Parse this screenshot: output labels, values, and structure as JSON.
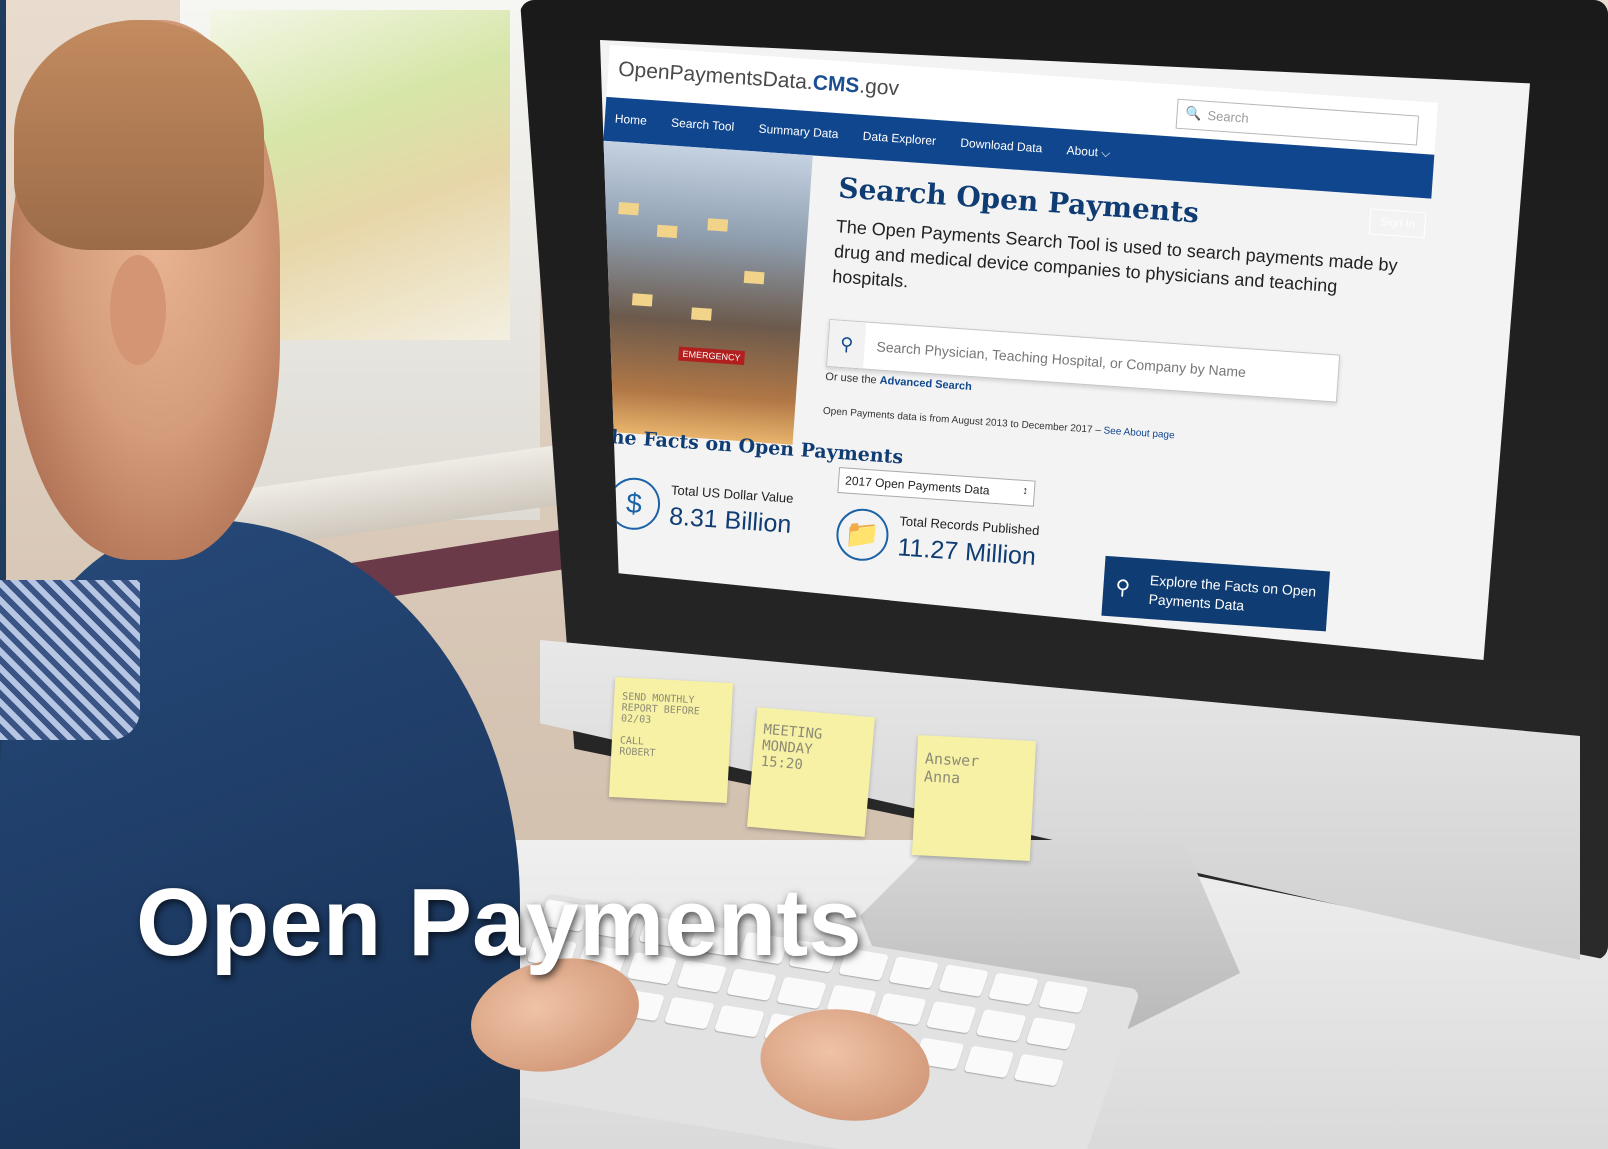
{
  "slide": {
    "title": "Open Payments"
  },
  "site": {
    "logo_prefix": "OpenPaymentsData.",
    "logo_cms": "CMS",
    "logo_suffix": ".gov",
    "nav": [
      "Home",
      "Search Tool",
      "Summary Data",
      "Data Explorer",
      "Download Data",
      "About ⌵"
    ],
    "search_placeholder": "Search",
    "sign_in": "Sign In"
  },
  "hero": {
    "title": "Search Open Payments",
    "description": "The Open Payments Search Tool is used to search payments made by drug and medical device companies to physicians and teaching hospitals.",
    "search_placeholder": "Search Physician, Teaching Hospital, or Company by Name",
    "advanced_prefix": "Or use the",
    "advanced_link": "Advanced Search",
    "data_range": "Open Payments data is from August 2013 to December 2017 –",
    "about_link": "See About page",
    "building_sign": "EMERGENCY"
  },
  "facts": {
    "title": "The Facts on Open Payments",
    "year_select": "2017 Open Payments Data",
    "dollar_label": "Total US Dollar Value",
    "dollar_value": "8.31 Billion",
    "records_label": "Total Records Published",
    "records_value": "11.27 Million",
    "explore_button": "Explore the Facts on Open Payments Data"
  },
  "notes": [
    "SEND MONTHLY\nREPORT BEFORE\n02/03\n\nCALL\nROBERT",
    "MEETING\nMONDAY\n15:20",
    "Answer\nAnna"
  ],
  "colors": {
    "nav_blue": "#10468e",
    "title_blue": "#0f3c73",
    "note_yellow": "#f6f1a4"
  },
  "icons": [
    "search-icon",
    "dollar-icon",
    "folder-icon",
    "magnifier-icon",
    "chevron-down-icon"
  ]
}
